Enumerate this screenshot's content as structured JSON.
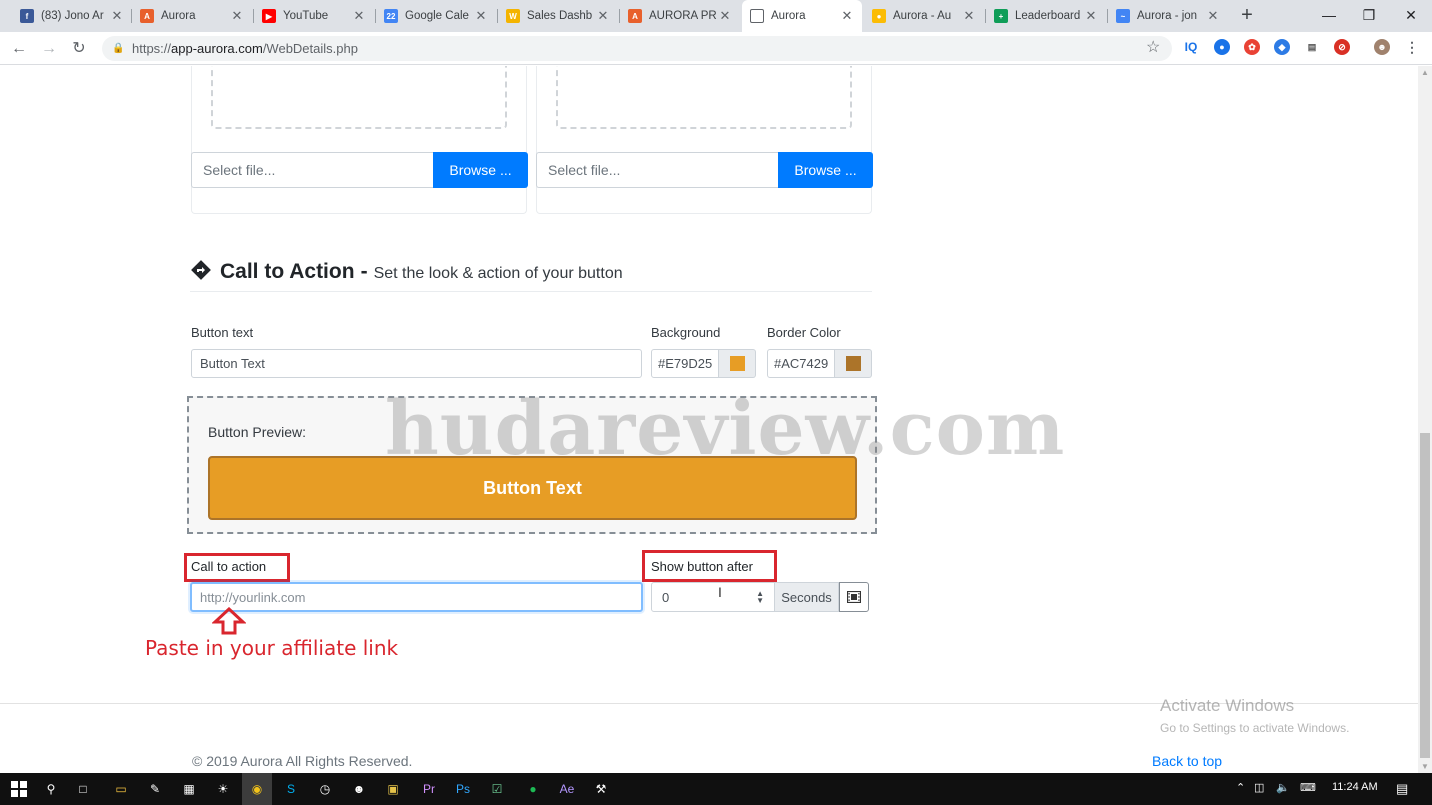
{
  "browser": {
    "tabs": [
      {
        "title": "(83) Jono Ar",
        "favicon_color": "#3b5998",
        "favicon_glyph": "f"
      },
      {
        "title": "Aurora",
        "favicon_color": "#e8602c",
        "favicon_glyph": "A"
      },
      {
        "title": "YouTube",
        "favicon_color": "#ff0000",
        "favicon_glyph": "▶"
      },
      {
        "title": "Google Cale",
        "favicon_color": "#4285f4",
        "favicon_glyph": "22"
      },
      {
        "title": "Sales Dashb",
        "favicon_color": "#f4b400",
        "favicon_glyph": "W"
      },
      {
        "title": "AURORA PR",
        "favicon_color": "#e8602c",
        "favicon_glyph": "A"
      },
      {
        "title": "Aurora",
        "favicon_color": "#ffffff",
        "favicon_glyph": ""
      },
      {
        "title": "Aurora - Au",
        "favicon_color": "#fbbc05",
        "favicon_glyph": "●"
      },
      {
        "title": "Leaderboard",
        "favicon_color": "#0f9d58",
        "favicon_glyph": "+"
      },
      {
        "title": "Aurora - jon",
        "favicon_color": "#4285f4",
        "favicon_glyph": "~"
      }
    ],
    "url": {
      "scheme": "https://",
      "host": "app-aurora.com",
      "path": "/WebDetails.php"
    }
  },
  "upload": {
    "left": {
      "placeholder": "Select file...",
      "browse_label": "Browse ..."
    },
    "right": {
      "placeholder": "Select file...",
      "browse_label": "Browse ..."
    }
  },
  "cta_section": {
    "title": "Call to Action",
    "dash": "-",
    "subtitle": "Set the look & action of your button",
    "button_text_label": "Button text",
    "button_text_placeholder": "Button Text",
    "background_label": "Background",
    "background_value": "#E79D25",
    "border_label": "Border Color",
    "border_value": "#AC7429",
    "preview_label": "Button Preview:",
    "preview_button_text": "Button Text",
    "call_to_action_label": "Call to action",
    "call_to_action_placeholder": "http://yourlink.com",
    "show_after_label": "Show button after",
    "show_after_value": "0",
    "seconds_label": "Seconds"
  },
  "annotation": {
    "note": "Paste in your affiliate link",
    "watermark": "hudareview.com"
  },
  "footer": {
    "copyright": "© 2019 Aurora All Rights Reserved.",
    "back_to_top": "Back to top"
  },
  "os": {
    "activate_title": "Activate Windows",
    "activate_sub": "Go to Settings to activate Windows.",
    "clock": "11:24 AM"
  },
  "colors": {
    "accent_blue": "#007bff",
    "annotation_red": "#d9262e",
    "preview_bg": "#E79D25",
    "preview_border": "#AC7429"
  }
}
